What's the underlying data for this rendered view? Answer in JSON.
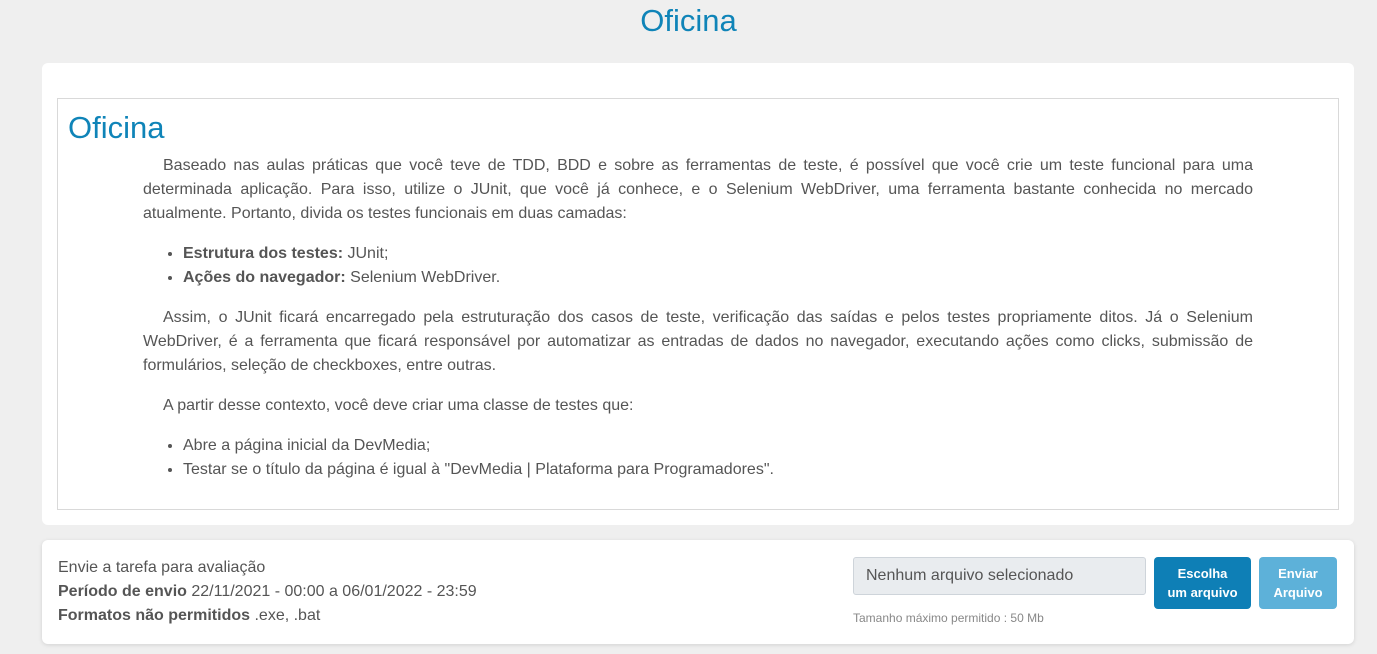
{
  "header": {
    "title": "Oficina"
  },
  "content": {
    "title": "Oficina",
    "paragraph1": "Baseado nas aulas práticas que você teve de TDD, BDD e sobre as ferramentas de teste, é possível que você crie um teste funcional para uma determinada aplicação. Para isso, utilize o JUnit, que você já conhece, e o Selenium WebDriver, uma ferramenta bastante conhecida no mercado atualmente. Portanto, divida os testes funcionais em duas camadas:",
    "layers": [
      {
        "label": "Estrutura dos testes:",
        "value": " JUnit;"
      },
      {
        "label": "Ações do navegador:",
        "value": " Selenium WebDriver."
      }
    ],
    "paragraph2": "Assim, o JUnit ficará encarregado pela estruturação dos casos de teste, verificação das saídas e pelos testes propriamente ditos. Já o Selenium WebDriver, é a ferramenta que ficará responsável por automatizar as entradas de dados no navegador, executando ações como clicks, submissão de formulários, seleção de checkboxes, entre outras.",
    "paragraph3": "A partir desse contexto, você deve criar uma classe de testes que:",
    "tasks": [
      "Abre a página inicial da DevMedia;",
      "Testar se o título da página é igual à \"DevMedia | Plataforma para Programadores\"."
    ]
  },
  "submission": {
    "heading": "Envie a tarefa para avaliação",
    "period_label": "Período de envio",
    "period_value": " 22/11/2021 - 00:00 a 06/01/2022 - 23:59",
    "formats_label": "Formatos não permitidos",
    "formats_value": " .exe, .bat",
    "file_placeholder": "Nenhum arquivo selecionado",
    "choose_label_line1": "Escolha",
    "choose_label_line2": "um arquivo",
    "send_label_line1": "Enviar",
    "send_label_line2": "Arquivo",
    "size_hint": "Tamanho máximo permitido : 50 Mb"
  },
  "colors": {
    "accent": "#0f84b8",
    "button_primary": "#0e7fb6",
    "button_disabled": "#5db1d9",
    "background": "#efefef"
  }
}
